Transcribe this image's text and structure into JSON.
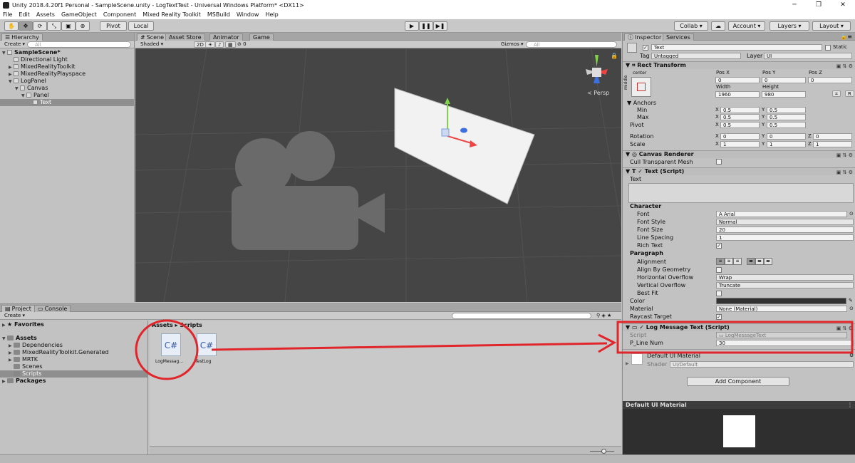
{
  "window": {
    "title": "Unity 2018.4.20f1 Personal - SampleScene.unity - LogTextTest - Universal Windows Platform* <DX11>"
  },
  "menu": [
    "File",
    "Edit",
    "Assets",
    "GameObject",
    "Component",
    "Mixed Reality Toolkit",
    "MSBuild",
    "Window",
    "Help"
  ],
  "toolbar": {
    "pivot": "Pivot",
    "local": "Local",
    "collab": "Collab ▾",
    "account": "Account",
    "layers": "Layers",
    "layout": "Layout"
  },
  "hierarchy": {
    "tab": "Hierarchy",
    "create": "Create ▾",
    "search": "All",
    "items": [
      {
        "label": "SampleScene*",
        "indent": 0,
        "bold": true,
        "arrow": "▼"
      },
      {
        "label": "Directional Light",
        "indent": 1,
        "arrow": ""
      },
      {
        "label": "MixedRealityToolkit",
        "indent": 1,
        "arrow": "▶"
      },
      {
        "label": "MixedRealityPlayspace",
        "indent": 1,
        "arrow": "▶"
      },
      {
        "label": "LogPanel",
        "indent": 1,
        "arrow": "▼"
      },
      {
        "label": "Canvas",
        "indent": 2,
        "arrow": "▼"
      },
      {
        "label": "Panel",
        "indent": 3,
        "arrow": "▼"
      },
      {
        "label": "Text",
        "indent": 4,
        "arrow": "",
        "selected": true
      }
    ]
  },
  "scene": {
    "tabs": [
      "Scene",
      "Asset Store",
      "Animator",
      "Game"
    ],
    "shading": "Shaded",
    "mode2d": "2D",
    "gizmos": "Gizmos ▾",
    "search": "All",
    "persp": "≺ Persp"
  },
  "project": {
    "tabs": [
      "Project",
      "Console"
    ],
    "create": "Create ▾",
    "favorites": "Favorites",
    "tree": [
      {
        "label": "Assets",
        "indent": 0,
        "bold": true,
        "arrow": "▼"
      },
      {
        "label": "Dependencies",
        "indent": 1,
        "arrow": "▶"
      },
      {
        "label": "MixedRealityToolkit.Generated",
        "indent": 1,
        "arrow": "▶"
      },
      {
        "label": "MRTK",
        "indent": 1,
        "arrow": "▶"
      },
      {
        "label": "Scenes",
        "indent": 1,
        "arrow": ""
      },
      {
        "label": "Scripts",
        "indent": 1,
        "arrow": "",
        "selected": true
      },
      {
        "label": "Packages",
        "indent": 0,
        "bold": true,
        "arrow": "▶"
      }
    ],
    "breadcrumb": "Assets ▸ Scripts",
    "files": [
      {
        "label": "LogMessag...",
        "icon": "C#"
      },
      {
        "label": "TestLog",
        "icon": "C#"
      }
    ]
  },
  "inspector": {
    "tabs": [
      "Inspector",
      "Services"
    ],
    "object": {
      "name": "Text",
      "static": "Static",
      "tag_label": "Tag",
      "tag": "Untagged",
      "layer_label": "Layer",
      "layer": "UI"
    },
    "rect": {
      "title": "Rect Transform",
      "center": "center",
      "middle": "middle",
      "headers": [
        "Pos X",
        "Pos Y",
        "Pos Z"
      ],
      "pos": [
        "0",
        "0",
        "0"
      ],
      "size_headers": [
        "Width",
        "Height"
      ],
      "size": [
        "1960",
        "980"
      ],
      "anchors": "Anchors",
      "min": "Min",
      "max": "Max",
      "pivot": "Pivot",
      "min_x": "0.5",
      "min_y": "0.5",
      "max_x": "0.5",
      "max_y": "0.5",
      "pivot_x": "0.5",
      "pivot_y": "0.5",
      "rotation": "Rotation",
      "rot": [
        "0",
        "0",
        "0"
      ],
      "scale": "Scale",
      "scl": [
        "1",
        "1",
        "1"
      ],
      "x": "X",
      "y": "Y",
      "z": "Z"
    },
    "canvas_renderer": {
      "title": "Canvas Renderer",
      "cull": "Cull Transparent Mesh"
    },
    "text_script": {
      "title": "Text (Script)",
      "text_label": "Text",
      "character": "Character",
      "font_label": "Font",
      "font": "Arial",
      "style_label": "Font Style",
      "style": "Normal",
      "size_label": "Font Size",
      "size": "20",
      "spacing_label": "Line Spacing",
      "spacing": "1",
      "rich_label": "Rich Text",
      "paragraph": "Paragraph",
      "align_label": "Alignment",
      "geom_label": "Align By Geometry",
      "hover_label": "Horizontal Overflow",
      "hover": "Wrap",
      "vover_label": "Vertical Overflow",
      "vover": "Truncate",
      "best_label": "Best Fit",
      "color_label": "Color",
      "material_label": "Material",
      "material": "None (Material)",
      "raycast_label": "Raycast Target"
    },
    "log_script": {
      "title": "Log Message Text (Script)",
      "script_label": "Script",
      "script": "LogMessageText",
      "pline_label": "P_Line Num",
      "pline": "30"
    },
    "material": {
      "name": "Default UI Material",
      "shader_label": "Shader",
      "shader": "UI/Default"
    },
    "add_component": "Add Component",
    "preview_title": "Default UI Material"
  },
  "colors": {
    "annotation": "#e0262b",
    "scene_bg": "#454545",
    "selection": "#8f8f8f"
  }
}
